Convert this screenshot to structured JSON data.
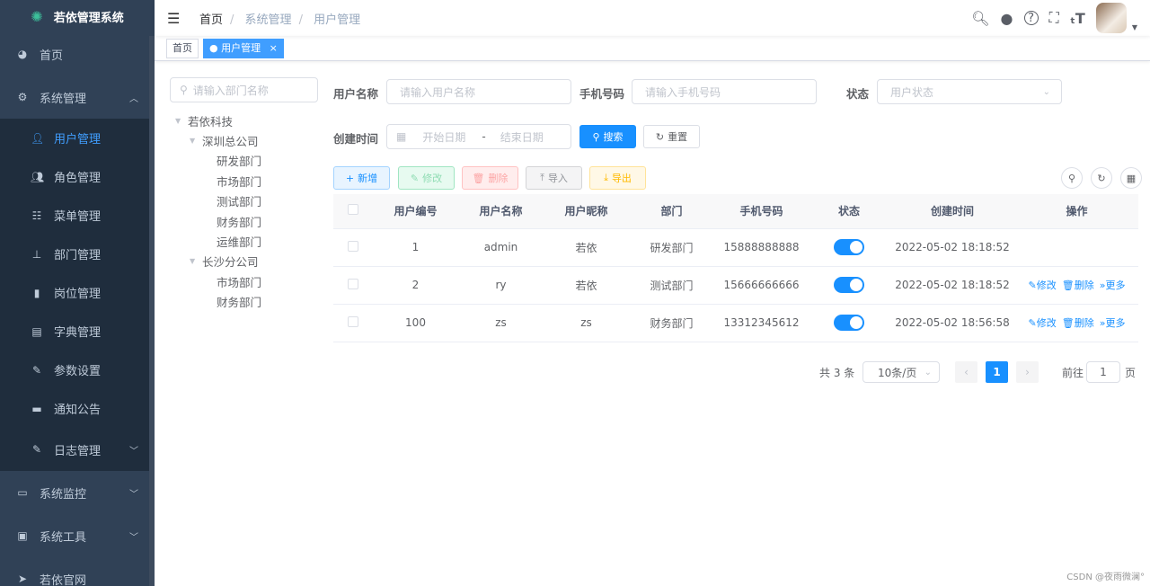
{
  "app": {
    "title": "若依管理系统"
  },
  "sidebar": {
    "items": [
      {
        "label": "首页",
        "icon": "dashboard-icon"
      },
      {
        "label": "系统管理",
        "icon": "gear-icon",
        "expanded": true,
        "children": [
          {
            "label": "用户管理",
            "icon": "user-icon",
            "active": true
          },
          {
            "label": "角色管理",
            "icon": "peoples-icon"
          },
          {
            "label": "菜单管理",
            "icon": "tree-table-icon"
          },
          {
            "label": "部门管理",
            "icon": "tree-icon"
          },
          {
            "label": "岗位管理",
            "icon": "post-icon"
          },
          {
            "label": "字典管理",
            "icon": "dict-icon"
          },
          {
            "label": "参数设置",
            "icon": "edit-icon"
          },
          {
            "label": "通知公告",
            "icon": "message-icon"
          },
          {
            "label": "日志管理",
            "icon": "log-icon"
          }
        ]
      },
      {
        "label": "系统监控",
        "icon": "monitor-icon"
      },
      {
        "label": "系统工具",
        "icon": "tool-icon"
      },
      {
        "label": "若依官网",
        "icon": "guide-icon"
      }
    ]
  },
  "breadcrumb": [
    "首页",
    "系统管理",
    "用户管理"
  ],
  "tags": [
    {
      "label": "首页"
    },
    {
      "label": "用户管理",
      "active": true,
      "close": "×"
    }
  ],
  "tree": {
    "placeholder": "请输入部门名称",
    "nodes": [
      {
        "label": "若依科技",
        "level": 0,
        "arrow": true
      },
      {
        "label": "深圳总公司",
        "level": 1,
        "arrow": true
      },
      {
        "label": "研发部门",
        "level": 2
      },
      {
        "label": "市场部门",
        "level": 2
      },
      {
        "label": "测试部门",
        "level": 2
      },
      {
        "label": "财务部门",
        "level": 2
      },
      {
        "label": "运维部门",
        "level": 2
      },
      {
        "label": "长沙分公司",
        "level": 1,
        "arrow": true
      },
      {
        "label": "市场部门",
        "level": 2
      },
      {
        "label": "财务部门",
        "level": 2
      }
    ]
  },
  "form": {
    "username_label": "用户名称",
    "username_ph": "请输入用户名称",
    "phone_label": "手机号码",
    "phone_ph": "请输入手机号码",
    "status_label": "状态",
    "status_ph": "用户状态",
    "time_label": "创建时间",
    "start_ph": "开始日期",
    "sep": "-",
    "end_ph": "结束日期",
    "search": "搜索",
    "reset": "重置"
  },
  "toolbar": {
    "add": "新增",
    "edit": "修改",
    "delete": "删除",
    "import": "导入",
    "export": "导出"
  },
  "table": {
    "headers": [
      "用户编号",
      "用户名称",
      "用户昵称",
      "部门",
      "手机号码",
      "状态",
      "创建时间",
      "操作"
    ],
    "rows": [
      {
        "id": "1",
        "name": "admin",
        "nick": "若依",
        "dept": "研发部门",
        "phone": "15888888888",
        "status": true,
        "time": "2022-05-02 18:18:52"
      },
      {
        "id": "2",
        "name": "ry",
        "nick": "若依",
        "dept": "测试部门",
        "phone": "15666666666",
        "status": true,
        "time": "2022-05-02 18:18:52"
      },
      {
        "id": "100",
        "name": "zs",
        "nick": "zs",
        "dept": "财务部门",
        "phone": "13312345612",
        "status": true,
        "time": "2022-05-02 18:56:58"
      }
    ],
    "op_edit": "修改",
    "op_delete": "删除",
    "op_more": "更多"
  },
  "pagination": {
    "total": "共 3 条",
    "size": "10条/页",
    "page": "1",
    "goto": "前往",
    "goto_val": "1",
    "page_unit": "页"
  },
  "watermark": "CSDN @夜雨微澜°",
  "colors": {
    "primary": "#1890ff",
    "sidebar": "#304156"
  }
}
